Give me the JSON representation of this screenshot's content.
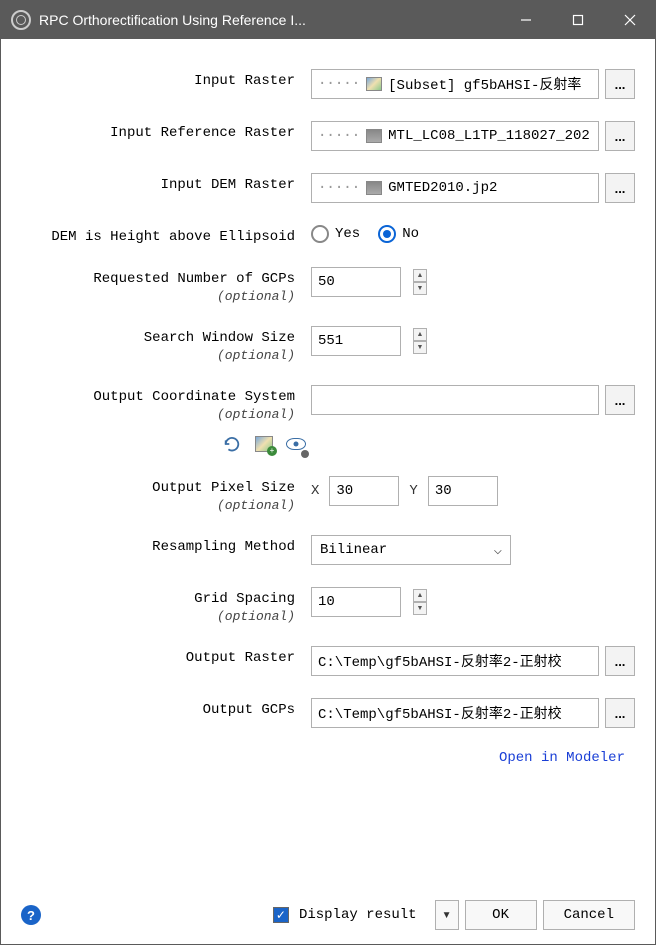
{
  "window": {
    "title": "RPC Orthorectification Using Reference I..."
  },
  "labels": {
    "input_raster": "Input Raster",
    "input_reference": "Input Reference Raster",
    "input_dem": "Input DEM Raster",
    "dem_ellipsoid": "DEM is Height above Ellipsoid",
    "requested_gcps": "Requested Number of GCPs",
    "search_window": "Search Window Size",
    "output_crs": "Output Coordinate System",
    "output_pixel": "Output Pixel Size",
    "resampling": "Resampling Method",
    "grid_spacing": "Grid Spacing",
    "output_raster": "Output Raster",
    "output_gcps": "Output GCPs",
    "optional": "(optional)",
    "yes": "Yes",
    "no": "No",
    "x": "X",
    "y": "Y"
  },
  "values": {
    "input_raster": "[Subset] gf5bAHSI-反射率",
    "input_reference": "MTL_LC08_L1TP_118027_202",
    "input_dem": "GMTED2010.jp2",
    "dem_ellipsoid": "No",
    "requested_gcps": "50",
    "search_window": "551",
    "output_crs": "",
    "pixel_x": "30",
    "pixel_y": "30",
    "resampling": "Bilinear",
    "grid_spacing": "10",
    "output_raster": "C:\\Temp\\gf5bAHSI-反射率2-正射校",
    "output_gcps": "C:\\Temp\\gf5bAHSI-反射率2-正射校"
  },
  "footer": {
    "modeler": "Open in Modeler",
    "display_result": "Display result",
    "display_result_checked": true,
    "ok": "OK",
    "cancel": "Cancel"
  },
  "browse": "..."
}
